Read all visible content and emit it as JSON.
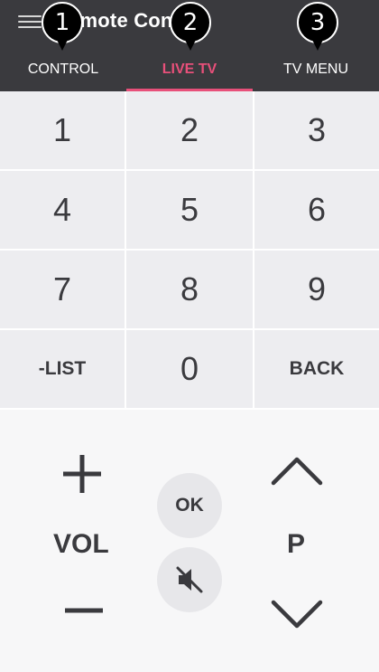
{
  "header": {
    "title": "Remote Control",
    "tabs": [
      {
        "label": "CONTROL",
        "active": false
      },
      {
        "label": "LIVE TV",
        "active": true
      },
      {
        "label": "TV MENU",
        "active": false
      }
    ],
    "callouts": [
      "1",
      "2",
      "3"
    ]
  },
  "keypad": {
    "keys": [
      "1",
      "2",
      "3",
      "4",
      "5",
      "6",
      "7",
      "8",
      "9",
      "-LIST",
      "0",
      "BACK"
    ]
  },
  "controls": {
    "volume_label": "VOL",
    "channel_label": "P",
    "ok_label": "OK",
    "icons": [
      "plus-icon",
      "minus-icon",
      "chevron-up-icon",
      "chevron-down-icon",
      "mute-icon",
      "menu-icon"
    ]
  },
  "colors": {
    "header_bg": "#3a3a3e",
    "accent": "#e8507a",
    "key_bg": "#ededf0",
    "text": "#3a3a3e"
  }
}
